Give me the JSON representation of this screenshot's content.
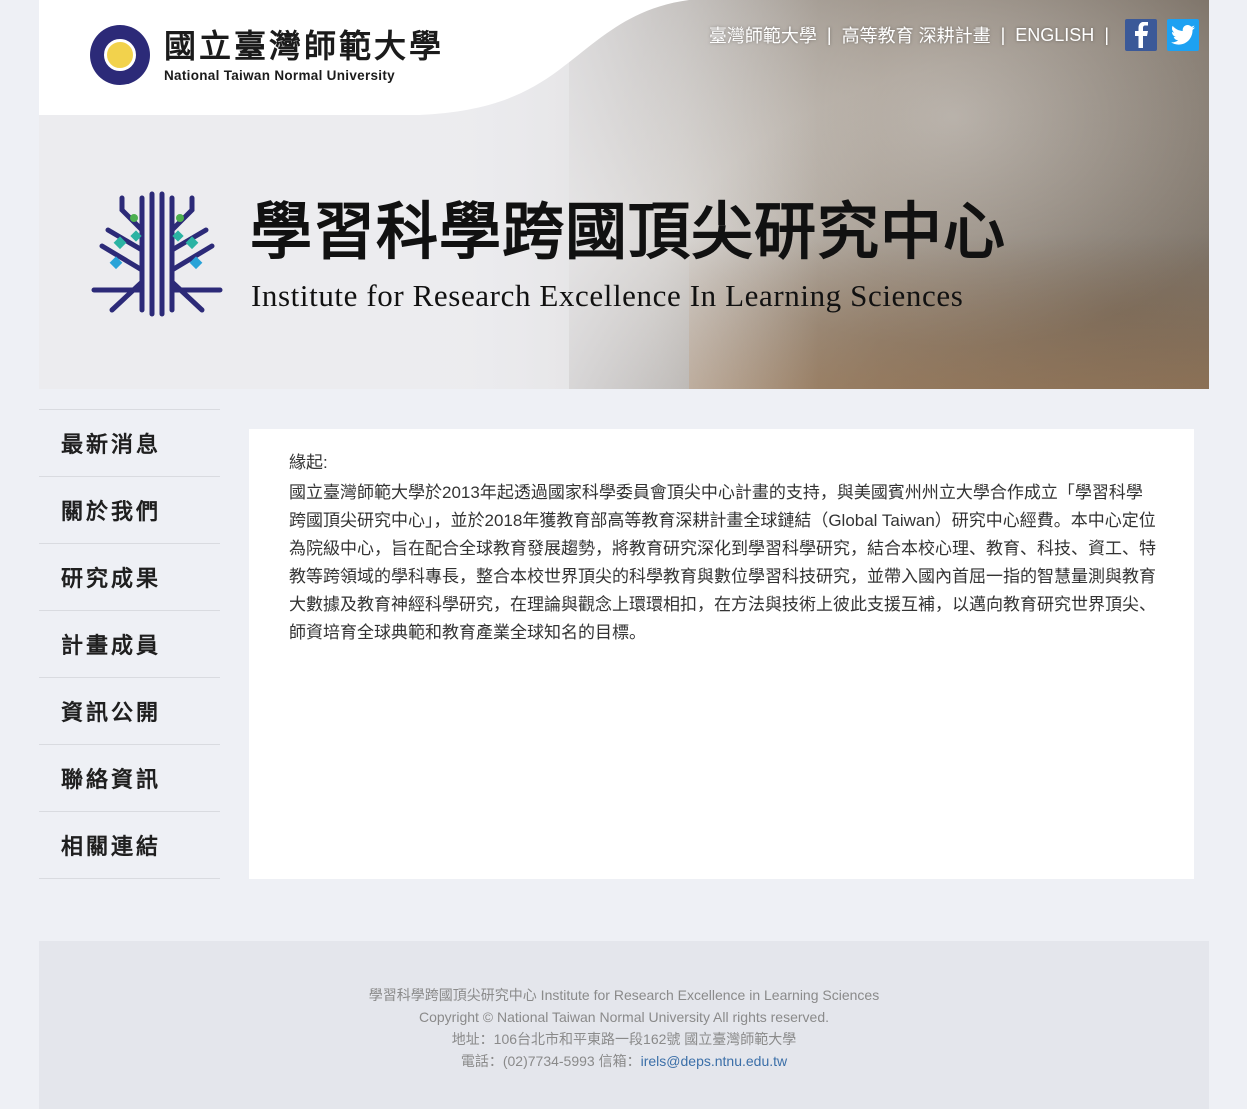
{
  "header": {
    "university": {
      "name_zh": "國立臺灣師範大學",
      "name_en": "National Taiwan Normal University"
    },
    "top_links": [
      {
        "label": "臺灣師範大學"
      },
      {
        "label": "高等教育 深耕計畫"
      },
      {
        "label": "ENGLISH"
      }
    ],
    "separator": "|",
    "social": [
      {
        "icon": "facebook-icon",
        "color": "#3b5998"
      },
      {
        "icon": "twitter-icon",
        "color": "#1da1f2"
      }
    ],
    "institute": {
      "title_zh": "學習科學跨國頂尖研究中心",
      "title_en": "Institute for Research Excellence In Learning Sciences"
    }
  },
  "sidebar": {
    "items": [
      {
        "label": "最新消息"
      },
      {
        "label": "關於我們"
      },
      {
        "label": "研究成果"
      },
      {
        "label": "計畫成員"
      },
      {
        "label": "資訊公開"
      },
      {
        "label": "聯絡資訊"
      },
      {
        "label": "相關連結"
      }
    ]
  },
  "main": {
    "heading": "緣起:",
    "body": "國立臺灣師範大學於2013年起透過國家科學委員會頂尖中心計畫的支持，與美國賓州州立大學合作成立「學習科學跨國頂尖研究中心」，並於2018年獲教育部高等教育深耕計畫全球鏈結（Global Taiwan）研究中心經費。本中心定位為院級中心，旨在配合全球教育發展趨勢，將教育研究深化到學習科學研究，結合本校心理、教育、科技、資工、特教等跨領域的學科專長，整合本校世界頂尖的科學教育與數位學習科技研究，並帶入國內首屈一指的智慧量測與教育大數據及教育神經科學研究，在理論與觀念上環環相扣，在方法與技術上彼此支援互補，以邁向教育研究世界頂尖、師資培育全球典範和教育產業全球知名的目標。"
  },
  "footer": {
    "line1": "學習科學跨國頂尖研究中心 Institute for Research Excellence in Learning Sciences",
    "line2": "Copyright © National Taiwan Normal University All rights reserved.",
    "line3": "地址：106台北市和平東路一段162號 國立臺灣師範大學",
    "phone_text": "電話：(02)7734-5993 信箱：",
    "email": "irels@deps.ntnu.edu.tw"
  },
  "colors": {
    "page_bg": "#eef0f5",
    "brand_navy": "#2c2a78",
    "link_blue": "#3b6fa8"
  }
}
